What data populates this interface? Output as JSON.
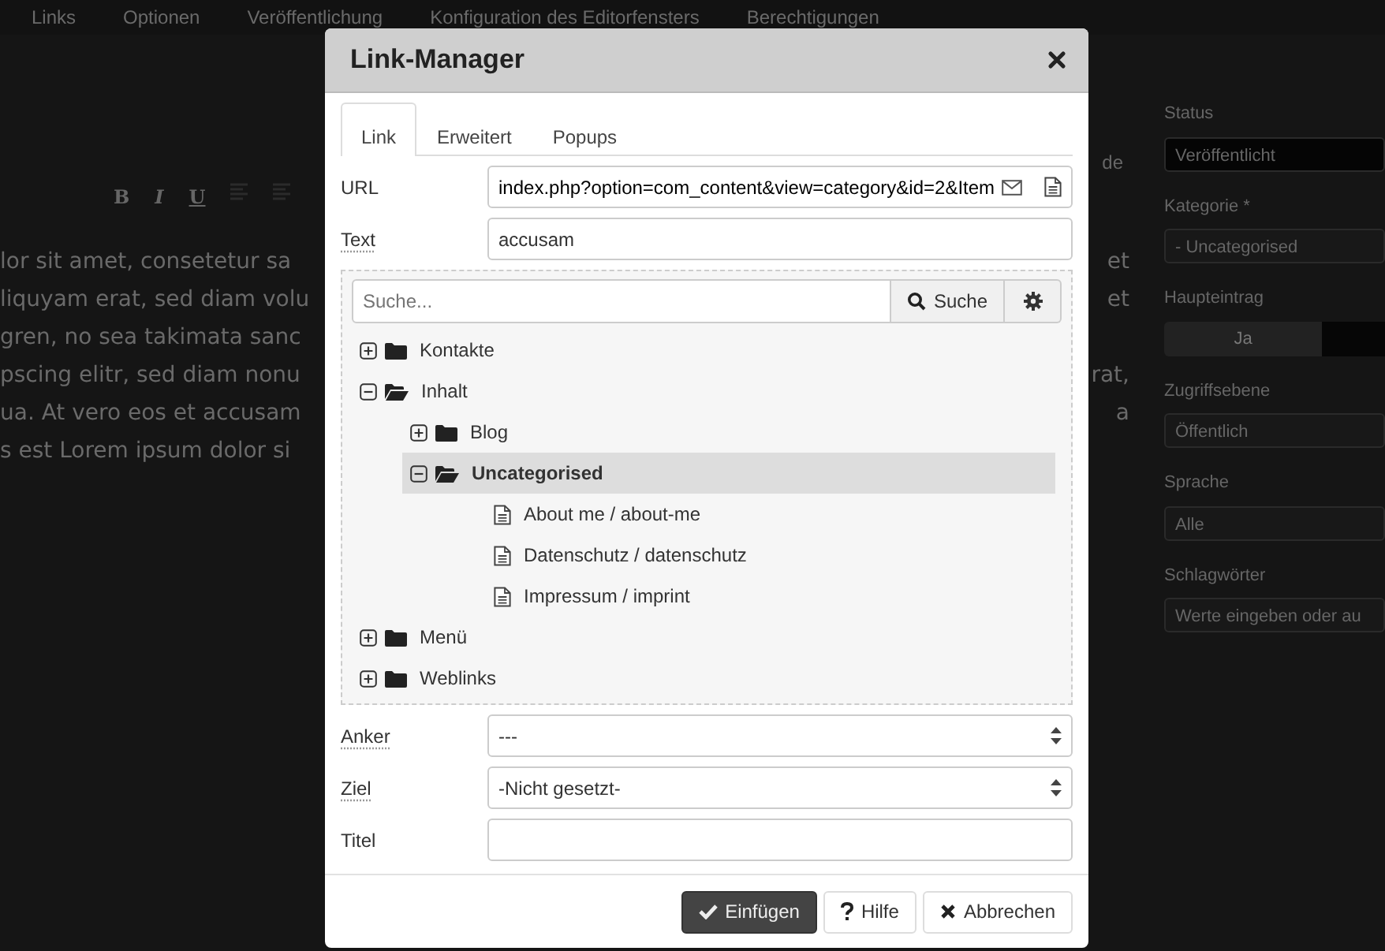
{
  "background": {
    "menu": [
      "Links",
      "Optionen",
      "Veröffentlichung",
      "Konfiguration des Editorfensters",
      "Berechtigungen"
    ],
    "editor_tab_fragment": "de",
    "toolbar": [
      "B",
      "I",
      "U"
    ],
    "editor_lines": [
      {
        "left": "lor sit amet, consetetur sa",
        "right": "et"
      },
      {
        "left": "liquyam erat, sed diam volu",
        "right": "et"
      },
      {
        "left": "gren, no sea takimata sanc"
      },
      {
        "left": "pscing elitr, sed diam nonu",
        "right": "rat,"
      },
      {
        "left": "ua. At vero eos et accusam",
        "right": "a"
      },
      {
        "left": "s est Lorem ipsum dolor si"
      }
    ],
    "sidebar": [
      {
        "label": "Status",
        "kind": "status",
        "value": "Veröffentlicht"
      },
      {
        "label": "Kategorie *",
        "kind": "select",
        "value": "- Uncategorised"
      },
      {
        "label": "Haupteintrag",
        "kind": "toggle",
        "value": "Ja"
      },
      {
        "label": "Zugriffsebene",
        "kind": "select",
        "value": "Öffentlich"
      },
      {
        "label": "Sprache",
        "kind": "select",
        "value": "Alle"
      },
      {
        "label": "Schlagwörter",
        "kind": "input",
        "placeholder": "Werte eingeben oder au"
      }
    ]
  },
  "dialog": {
    "title": "Link-Manager",
    "tabs": [
      {
        "label": "Link",
        "selected": true
      },
      {
        "label": "Erweitert",
        "selected": false
      },
      {
        "label": "Popups",
        "selected": false
      }
    ],
    "url": {
      "label": "URL",
      "value": "index.php?option=com_content&view=category&id=2&Item",
      "hint": false
    },
    "text": {
      "label": "Text",
      "value": "accusam",
      "hint": true
    },
    "search": {
      "placeholder": "Suche...",
      "button": "Suche"
    },
    "tree": [
      {
        "label": "Kontakte",
        "kind": "folder",
        "expanded": false,
        "selected": false
      },
      {
        "label": "Inhalt",
        "kind": "folder",
        "expanded": true,
        "selected": false,
        "children": [
          {
            "label": "Blog",
            "kind": "folder",
            "expanded": false,
            "selected": false
          },
          {
            "label": "Uncategorised",
            "kind": "folder",
            "expanded": true,
            "selected": true,
            "children": [
              {
                "label": "About me / about-me",
                "kind": "article",
                "selected": false
              },
              {
                "label": "Datenschutz / datenschutz",
                "kind": "article",
                "selected": false
              },
              {
                "label": "Impressum / imprint",
                "kind": "article",
                "selected": false
              }
            ]
          }
        ]
      },
      {
        "label": "Menü",
        "kind": "folder",
        "expanded": false,
        "selected": false
      },
      {
        "label": "Weblinks",
        "kind": "folder",
        "expanded": false,
        "selected": false
      }
    ],
    "anchor": {
      "label": "Anker",
      "value": "---",
      "hint": true
    },
    "target": {
      "label": "Ziel",
      "value": "-Nicht gesetzt-",
      "hint": true
    },
    "link_title": {
      "label": "Titel",
      "hint": false
    },
    "buttons": [
      {
        "label": "Einfügen",
        "kind": "primary"
      },
      {
        "label": "Hilfe",
        "kind": "help"
      },
      {
        "label": "Abbrechen",
        "kind": "cancel"
      }
    ]
  }
}
